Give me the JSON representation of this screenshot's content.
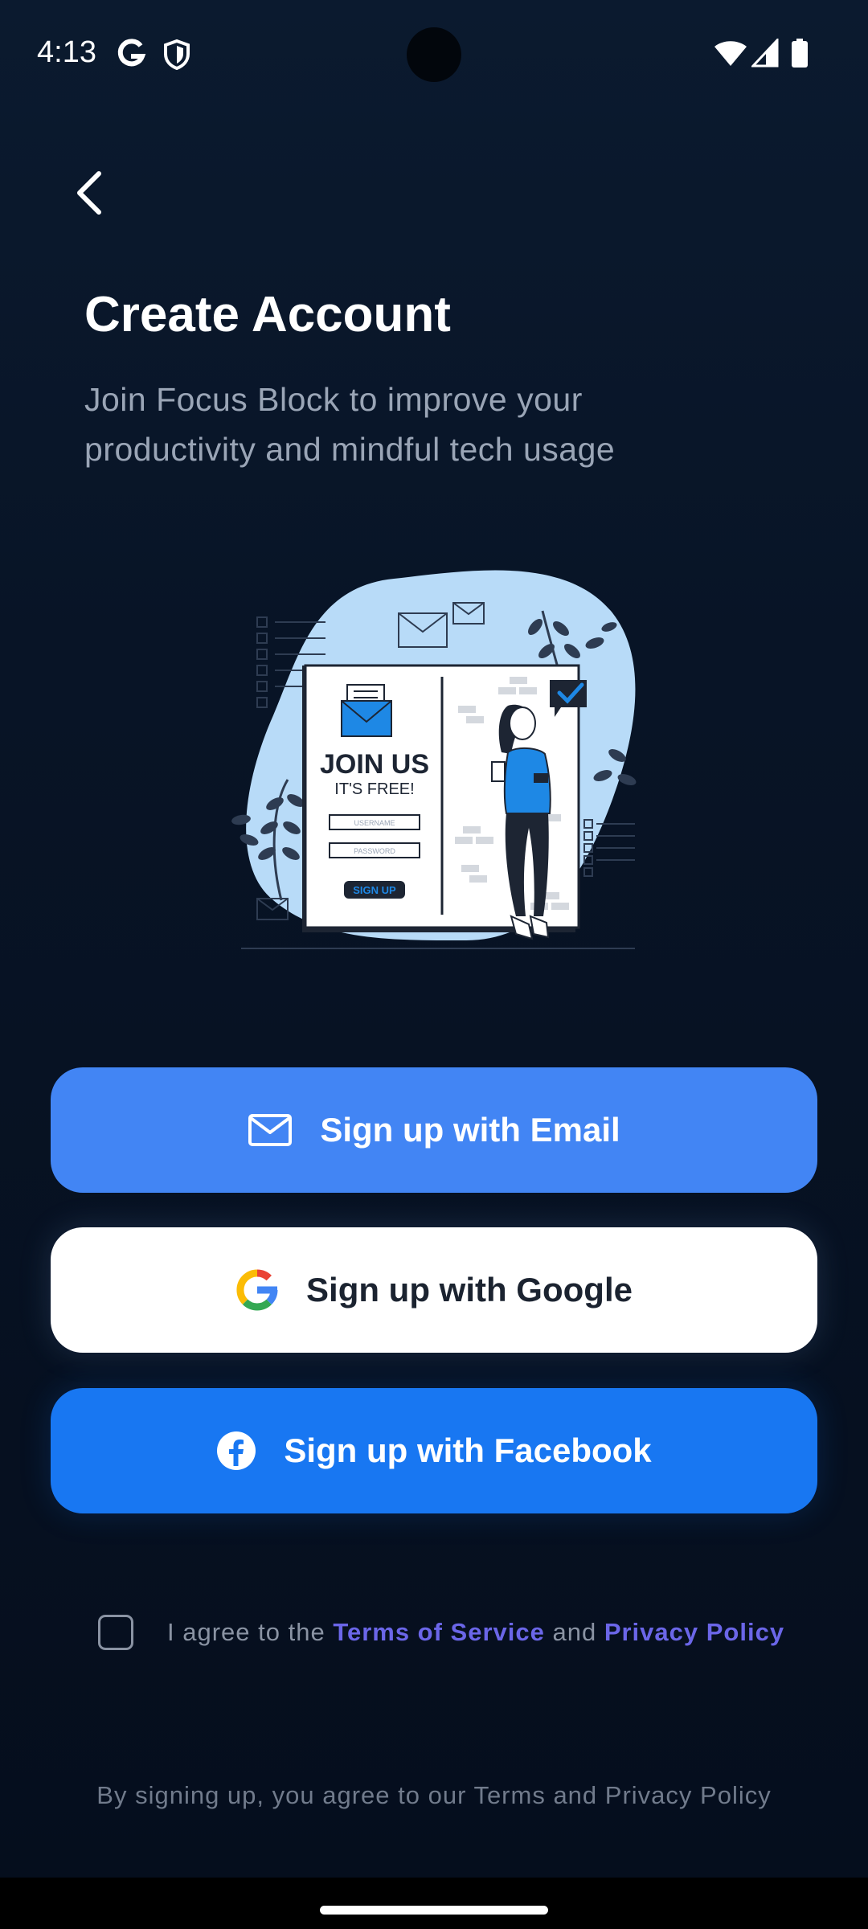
{
  "status_bar": {
    "time": "4:13",
    "left_icons": [
      "google-icon",
      "shield-icon"
    ],
    "right_icons": [
      "wifi-icon",
      "signal-icon",
      "battery-icon"
    ]
  },
  "header": {
    "title": "Create Account",
    "subtitle": "Join Focus Block to improve your productivity and mindful tech usage"
  },
  "illustration": {
    "heading": "JOIN US",
    "tagline": "IT'S FREE!",
    "username_placeholder": "USERNAME",
    "password_placeholder": "PASSWORD",
    "button_label": "SIGN UP"
  },
  "buttons": {
    "email": {
      "label": "Sign up with Email",
      "icon": "mail-icon"
    },
    "google": {
      "label": "Sign up with Google",
      "icon": "google-logo-icon"
    },
    "facebook": {
      "label": "Sign up with Facebook",
      "icon": "facebook-logo-icon"
    }
  },
  "terms": {
    "checked": false,
    "prefix": "I agree to the ",
    "terms_link": "Terms of Service",
    "joiner": " and ",
    "privacy_link": "Privacy Policy"
  },
  "footer": {
    "note": "By signing up, you agree to our Terms and Privacy Policy"
  },
  "colors": {
    "background": "#050e1d",
    "email_button": "#4285f4",
    "google_button": "#ffffff",
    "facebook_button": "#1877f2",
    "link": "#6b66e8",
    "illustration_blob": "#b8dbf8",
    "illustration_accent": "#1e88e5"
  }
}
